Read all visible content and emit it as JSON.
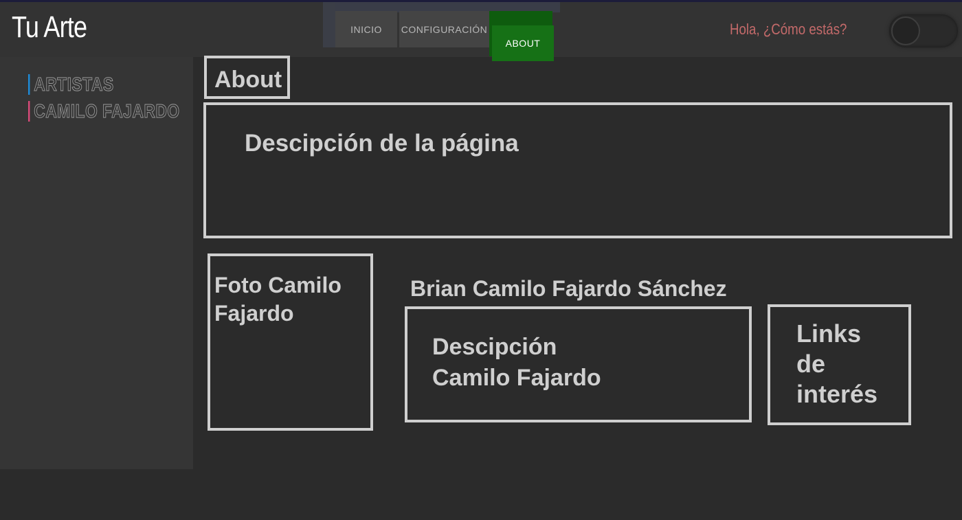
{
  "header": {
    "brand": "Tu Arte",
    "greeting": "Hola, ¿Cómo estás?"
  },
  "nav": {
    "tabs": [
      {
        "label": "INICIO"
      },
      {
        "label": "CONFIGURACIÓN"
      },
      {
        "label": "ABOUT"
      }
    ],
    "active_tab": "ABOUT",
    "active_color": "#167116"
  },
  "theme_toggle": {
    "state": "off"
  },
  "sidebar": {
    "items": [
      {
        "label": "ARTISTAS",
        "accent": "#1e8ad6"
      },
      {
        "label": "CAMILO FAJARDO",
        "accent": "#d64a78"
      }
    ]
  },
  "main": {
    "title": "About",
    "page_description": "Descipción de la página",
    "photo_label": "Foto Camilo Fajardo",
    "person_name": "Brian Camilo Fajardo Sánchez",
    "person_description": "Descipción Camilo Fajardo",
    "links_label": "Links de interés"
  }
}
